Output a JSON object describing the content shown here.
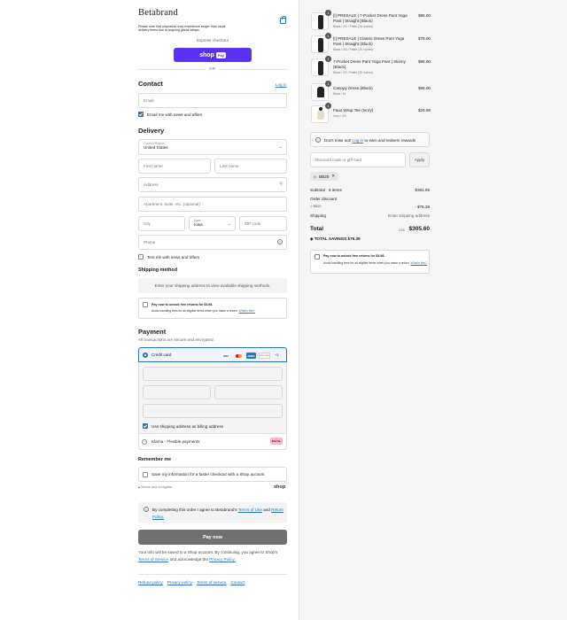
{
  "brand": {
    "logo": "Betabrand"
  },
  "notice": "Please note that shipments may experience longer than usual delivery times due to ongoing global delays.",
  "express": {
    "label": "Express checkout",
    "shop_pay": "shop",
    "pay_tag": "Pay",
    "or": "OR"
  },
  "contact": {
    "title": "Contact",
    "login": "Log in",
    "email_placeholder": "Email",
    "news_label": "Email me with news and offers"
  },
  "delivery": {
    "title": "Delivery",
    "country_label": "Country/Region",
    "country_value": "United States",
    "first_name": "First name",
    "last_name": "Last name",
    "address": "Address",
    "apartment": "Apartment, suite, etc. (optional)",
    "city": "City",
    "state_label": "State",
    "state_value": "Iowa",
    "zip": "ZIP code",
    "phone": "Phone",
    "text_me": "Text me with news and offers"
  },
  "shipping": {
    "title": "Shipping method",
    "placeholder": "Enter your shipping address to view available shipping methods.",
    "returns_title": "Pay now to unlock free returns for $3.98.",
    "returns_desc": "Avoid handling fees for all eligible items when you make a return.",
    "whats_this": "What's this?"
  },
  "payment": {
    "title": "Payment",
    "subtitle": "All transactions are secure and encrypted.",
    "credit_card": "Credit card",
    "cards": [
      "VISA",
      "MC",
      "AMEX",
      "DISCOVER"
    ],
    "more_cards": "+3",
    "billing_same": "Use shipping address as billing address",
    "klarna": "Klarna - Flexible payments",
    "klarna_badge": "Klarna."
  },
  "remember": {
    "title": "Remember me",
    "save_info": "Save my information for a faster checkout with a Shop account",
    "secure": "Secure and encrypted",
    "shop": "shop"
  },
  "consent": {
    "prefix": "By completing this order I agree to Betabrand's",
    "terms": "Terms of Use",
    "and": "and",
    "privacy": "Return Policy."
  },
  "pay_now": "Pay now",
  "shop_note": {
    "text": "Your info will be saved to a Shop account. By continuing, you agree to Shop's",
    "terms": "Terms of Service",
    "and": "and acknowledge the",
    "privacy": "Privacy Policy."
  },
  "footer_links": [
    "Refund policy",
    "Privacy policy",
    "Terms of service",
    "Contact"
  ],
  "cart": {
    "items": [
      {
        "qty": "1",
        "name": "[!] PRESALE | 7-Pocket Dress Pant Yoga Pant | Straight (Black)",
        "variant": "Black / XS / Petite (26 Inches)",
        "price": "$88.00",
        "thumb": "pants"
      },
      {
        "qty": "1",
        "name": "[!] PRESALE | Classic Dress Pant Yoga Pant | Straight (Black)",
        "variant": "Black / XS / Petite (26 Inches)",
        "price": "$78.00",
        "thumb": "pants"
      },
      {
        "qty": "1",
        "name": "7-Pocket Dress Pant Yoga Pant | Skinny (Black)",
        "variant": "Black / XS / Petite (26 Inches)",
        "price": "$88.00",
        "thumb": "pants"
      },
      {
        "qty": "1",
        "name": "Canopy Dress (Black)",
        "variant": "Black / M",
        "price": "$98.00",
        "thumb": "dress"
      },
      {
        "qty": "1",
        "name": "Faux Wrap Tee (Ivory)",
        "variant": "Ivory / XS",
        "price": "$29.99",
        "thumb": "tee"
      }
    ],
    "rewards": {
      "prefix": "Don't miss out!",
      "login": "Log in",
      "suffix": "to earn and redeem rewards"
    },
    "discount_placeholder": "Discount code or gift card",
    "apply": "Apply",
    "code": "BB20",
    "subtotal_label": "Subtotal · 5 items",
    "subtotal": "$381.99",
    "order_discount": "Order discount",
    "discount_code": "BB20",
    "discount_value": "- $76.39",
    "shipping_label": "Shipping",
    "shipping_value": "Enter shipping address",
    "total_label": "Total",
    "currency": "USD",
    "total": "$305.60",
    "savings_label": "TOTAL SAVINGS",
    "savings": "$76.39",
    "returns_title": "Pay now to unlock free returns for $3.98.",
    "returns_desc": "Avoid handling fees for all eligible items when you make a return.",
    "whats_this": "What's this?"
  }
}
